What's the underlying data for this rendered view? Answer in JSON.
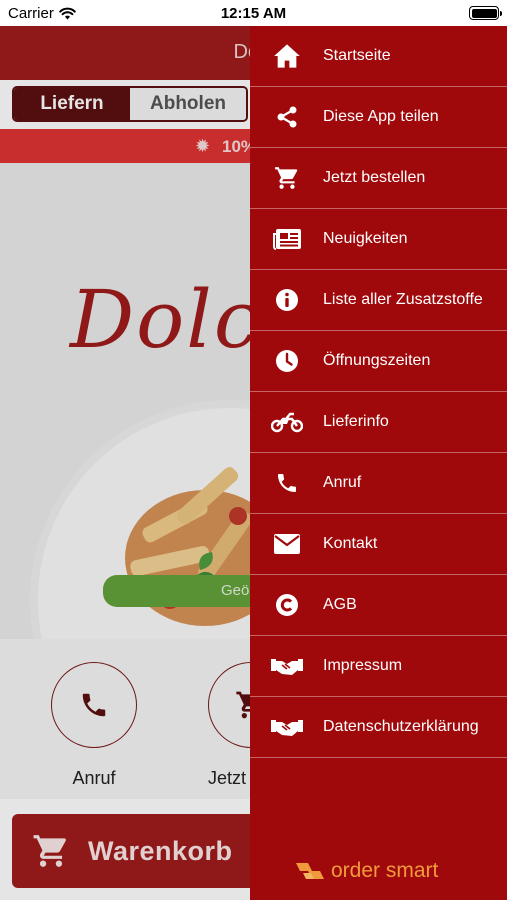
{
  "status_bar": {
    "carrier": "Carrier",
    "time": "12:15 AM"
  },
  "app": {
    "header_title": "Dolc",
    "segments": [
      {
        "label": "Liefern"
      },
      {
        "label": "Abholen"
      }
    ],
    "promo_text": "10%",
    "order_button_text": "Geö",
    "quick_actions": [
      {
        "label": "Anruf"
      },
      {
        "label": "Jetzt b"
      }
    ],
    "cart_label": "Warenkorb",
    "logo_text": "Dolce"
  },
  "menu": {
    "items": [
      {
        "label": "Startseite",
        "icon": "home-icon"
      },
      {
        "label": "Diese App teilen",
        "icon": "share-icon"
      },
      {
        "label": "Jetzt bestellen",
        "icon": "cart-icon"
      },
      {
        "label": "Neuigkeiten",
        "icon": "newspaper-icon"
      },
      {
        "label": "Liste aller Zusatzstoffe",
        "icon": "info-icon"
      },
      {
        "label": "Öffnungszeiten",
        "icon": "clock-icon"
      },
      {
        "label": "Lieferinfo",
        "icon": "motorcycle-icon"
      },
      {
        "label": "Anruf",
        "icon": "phone-icon"
      },
      {
        "label": "Kontakt",
        "icon": "envelope-icon"
      },
      {
        "label": "AGB",
        "icon": "copyright-icon"
      },
      {
        "label": "Impressum",
        "icon": "handshake-icon"
      },
      {
        "label": "Datenschutzerklärung",
        "icon": "handshake-icon"
      }
    ],
    "brand": "order smart"
  },
  "colors": {
    "menu_background": "#a0090b",
    "header_red": "#a01c1c",
    "promo_red": "#e03434",
    "order_green": "#62a33a",
    "brand_orange": "#ef9a3d"
  }
}
